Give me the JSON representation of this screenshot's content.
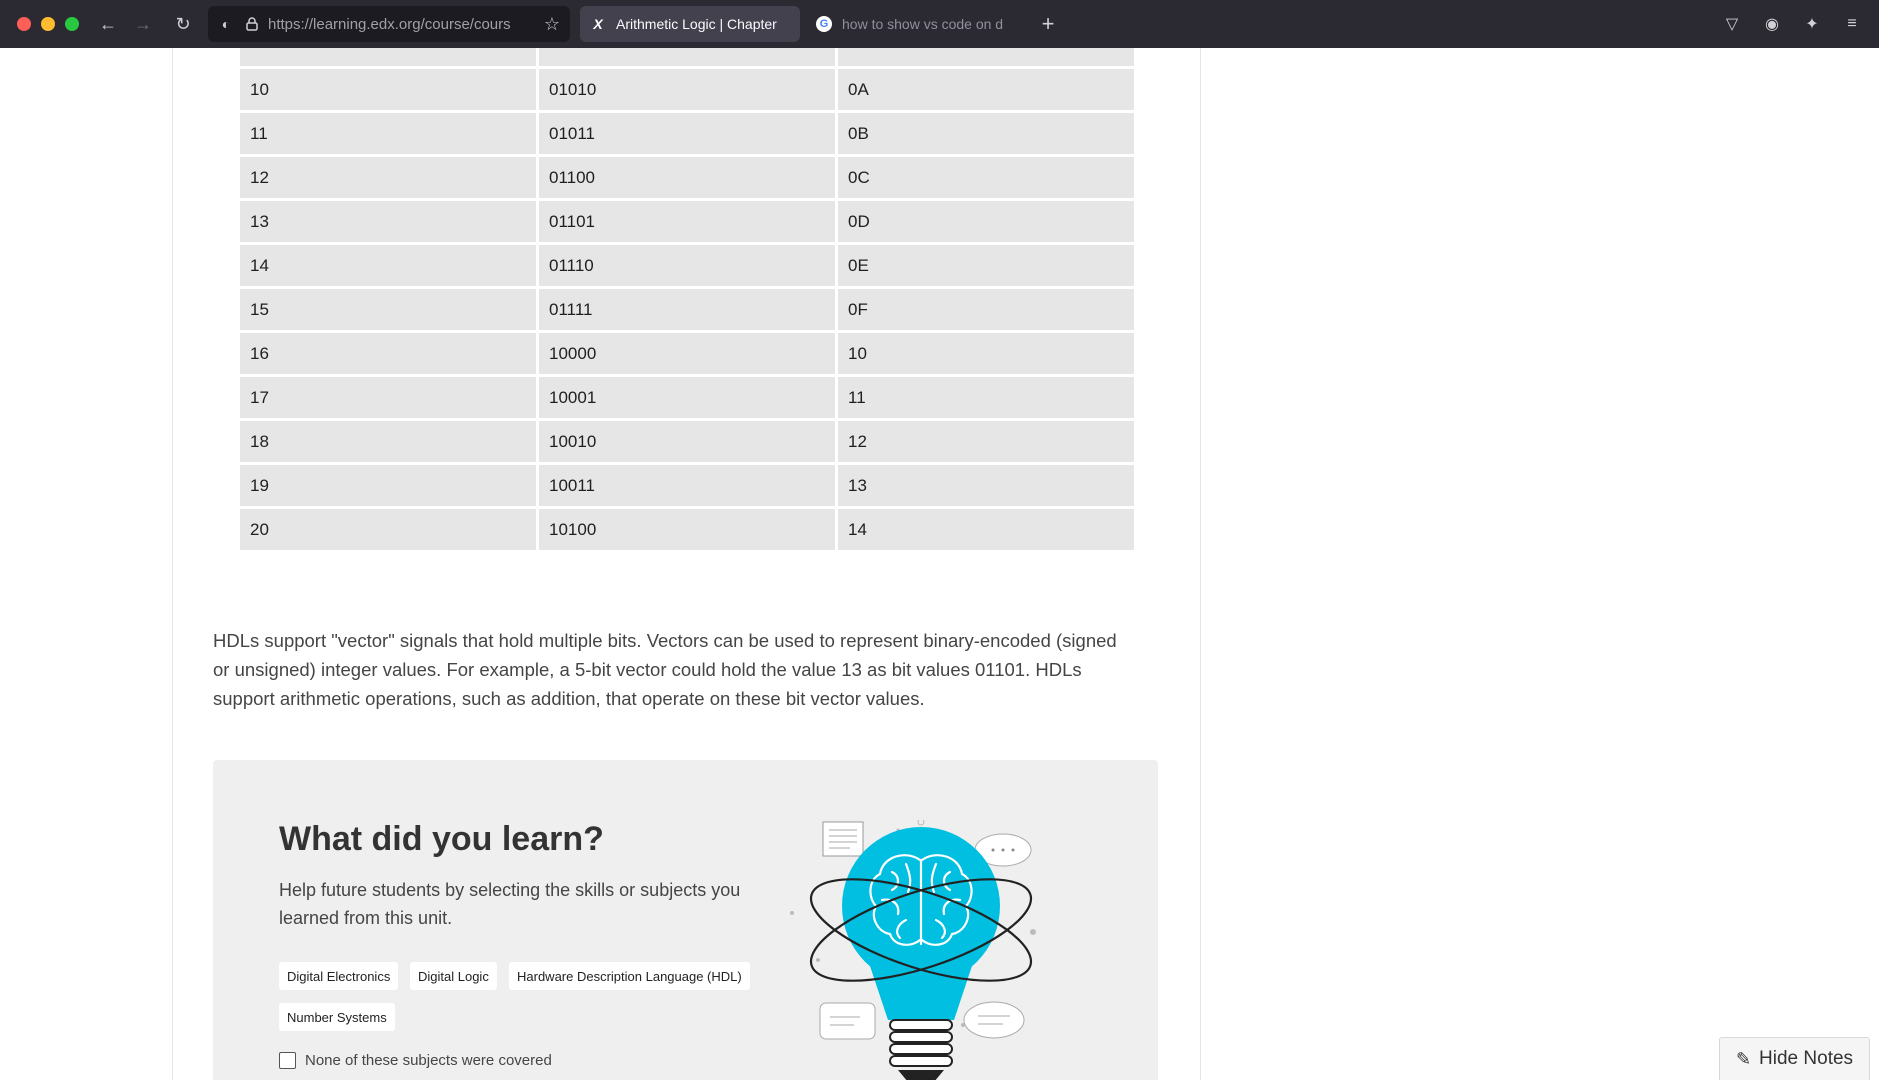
{
  "browser": {
    "url": "https://learning.edx.org/course/cours",
    "tabs": [
      {
        "title": "Arithmetic Logic | Chapter",
        "favicon": "edx-x-icon",
        "active": true
      },
      {
        "title": "how to show vs code on d",
        "favicon": "google-g-icon",
        "active": false
      }
    ],
    "icons": {
      "back": "←",
      "forward": "→",
      "reload": "↻",
      "shield": "◐",
      "lock": "🔒",
      "star": "☆",
      "new_tab": "+",
      "pocket": "▽",
      "account": "◉",
      "extensions": "✦",
      "menu": "≡"
    }
  },
  "table": {
    "rows": [
      [
        "10",
        "01010",
        "0A"
      ],
      [
        "11",
        "01011",
        "0B"
      ],
      [
        "12",
        "01100",
        "0C"
      ],
      [
        "13",
        "01101",
        "0D"
      ],
      [
        "14",
        "01110",
        "0E"
      ],
      [
        "15",
        "01111",
        "0F"
      ],
      [
        "16",
        "10000",
        "10"
      ],
      [
        "17",
        "10001",
        "11"
      ],
      [
        "18",
        "10010",
        "12"
      ],
      [
        "19",
        "10011",
        "13"
      ],
      [
        "20",
        "10100",
        "14"
      ]
    ]
  },
  "paragraph": "HDLs support \"vector\" signals that hold multiple bits. Vectors can be used to represent binary-encoded (signed or unsigned) integer values. For example, a 5-bit vector could hold the value 13 as bit values 01101. HDLs support arithmetic operations, such as addition, that operate on these bit vector values.",
  "learn": {
    "title": "What did you learn?",
    "description": "Help future students by selecting the skills or subjects you learned from this unit.",
    "chips": [
      "Digital Electronics",
      "Digital Logic",
      "Hardware Description Language (HDL)",
      "Number Systems"
    ],
    "none_label": "None of these subjects were covered"
  },
  "notes_button": "Hide Notes",
  "colors": {
    "accent_bulb": "#00bfe0",
    "chrome_bg": "#2b2a33",
    "table_cell": "#e6e6e6",
    "learn_bg": "#f0efef"
  }
}
